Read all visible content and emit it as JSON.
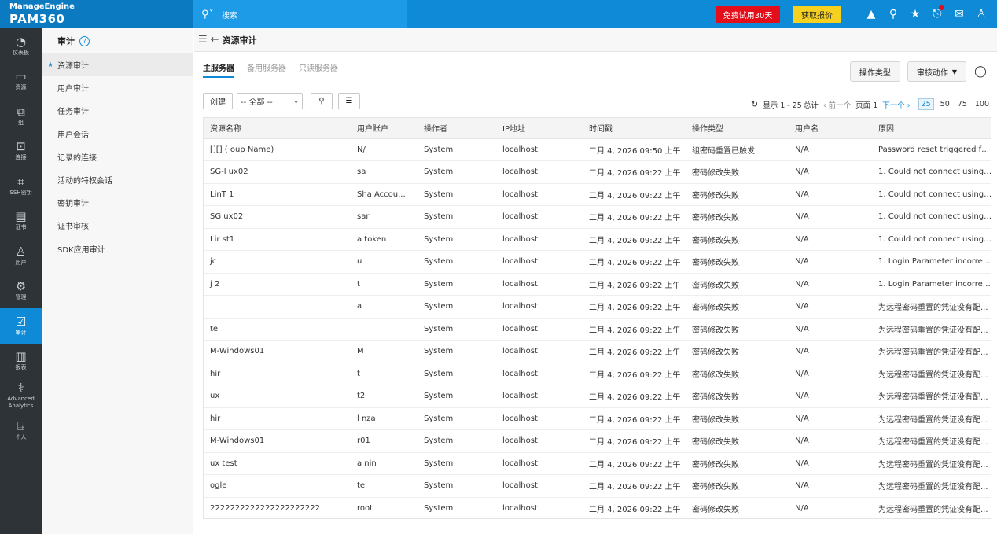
{
  "brand": {
    "line1": "ManageEngine",
    "line2": "PAM360"
  },
  "search": {
    "placeholder": "搜索"
  },
  "header_buttons": {
    "trial": "免费试用30天",
    "quote": "获取报价"
  },
  "leftnav": [
    {
      "icon": "dashboard-icon",
      "glyph": "◔",
      "label": "仪表板"
    },
    {
      "icon": "resources-icon",
      "glyph": "▭",
      "label": "资源"
    },
    {
      "icon": "groups-icon",
      "glyph": "⧉",
      "label": "组"
    },
    {
      "icon": "connections-icon",
      "glyph": "⊡",
      "label": "连接"
    },
    {
      "icon": "ssh-key-icon",
      "glyph": "⌗",
      "label": "SSH密钥"
    },
    {
      "icon": "certificate-icon",
      "glyph": "▤",
      "label": "证书"
    },
    {
      "icon": "users-icon",
      "glyph": "♙",
      "label": "用户"
    },
    {
      "icon": "admin-gear-icon",
      "glyph": "⚙",
      "label": "管理"
    },
    {
      "icon": "audit-icon",
      "glyph": "☑",
      "label": "审计",
      "active": true
    },
    {
      "icon": "reports-icon",
      "glyph": "▥",
      "label": "报表"
    },
    {
      "icon": "analytics-icon",
      "glyph": "⚕",
      "label": "Advanced Analytics"
    },
    {
      "icon": "personal-icon",
      "glyph": "⍈",
      "label": "个人"
    }
  ],
  "subnav": {
    "title": "审计",
    "help": "?",
    "items": [
      "资源审计",
      "用户审计",
      "任务审计",
      "用户会话",
      "记录的连接",
      "活动的特权会话",
      "密钥审计",
      "证书审核",
      "SDK应用审计"
    ]
  },
  "main": {
    "title": "资源审计",
    "tabs": [
      "主服务器",
      "备用服务器",
      "只读服务器"
    ],
    "btn_op_type": "操作类型",
    "btn_audit_action": "审核动作",
    "btn_create": "创建",
    "filter_value": "-- 全部 --",
    "paging": {
      "showing": "显示 1 - 25",
      "total": "总计",
      "prev": "‹ 前一个",
      "page": "页面 1",
      "next": "下一个 ›",
      "sizes": [
        "25",
        "50",
        "75",
        "100"
      ]
    }
  },
  "table": {
    "columns": [
      "资源名称",
      "用户账户",
      "操作者",
      "IP地址",
      "时间戳",
      "操作类型",
      "用户名",
      "原因"
    ],
    "rows": [
      [
        "[][] (  oup Name)",
        "N/",
        "System",
        "localhost",
        "二月 4, 2026 09:50 上午",
        "组密码重置已触发",
        "N/A",
        "Password reset triggered fo..."
      ],
      [
        "SG-l   ux02",
        "sa",
        "System",
        "localhost",
        "二月 4, 2026 09:22 上午",
        "密码修改失败",
        "N/A",
        "1. Could not connect using ..."
      ],
      [
        "LinT   1",
        "Sha   Accou...",
        "System",
        "localhost",
        "二月 4, 2026 09:22 上午",
        "密码修改失败",
        "N/A",
        "1. Could not connect using ..."
      ],
      [
        "SG   ux02",
        "sar",
        "System",
        "localhost",
        "二月 4, 2026 09:22 上午",
        "密码修改失败",
        "N/A",
        "1. Could not connect using ..."
      ],
      [
        "Lir   st1",
        "a   token",
        "System",
        "localhost",
        "二月 4, 2026 09:22 上午",
        "密码修改失败",
        "N/A",
        "1. Could not connect using ..."
      ],
      [
        "jc",
        "u",
        "System",
        "localhost",
        "二月 4, 2026 09:22 上午",
        "密码修改失败",
        "N/A",
        "1. Login Parameter incorrec..."
      ],
      [
        "j   2",
        "t",
        "System",
        "localhost",
        "二月 4, 2026 09:22 上午",
        "密码修改失败",
        "N/A",
        "1. Login Parameter incorrec..."
      ],
      [
        "",
        "a",
        "System",
        "localhost",
        "二月 4, 2026 09:22 上午",
        "密码修改失败",
        "N/A",
        "为远程密码重置的凭证没有配..."
      ],
      [
        "   te",
        "",
        "System",
        "localhost",
        "二月 4, 2026 09:22 上午",
        "密码修改失败",
        "N/A",
        "为远程密码重置的凭证没有配..."
      ],
      [
        "   M-Windows01",
        "   M",
        "System",
        "localhost",
        "二月 4, 2026 09:22 上午",
        "密码修改失败",
        "N/A",
        "为远程密码重置的凭证没有配..."
      ],
      [
        "   hir",
        "   t",
        "System",
        "localhost",
        "二月 4, 2026 09:22 上午",
        "密码修改失败",
        "N/A",
        "为远程密码重置的凭证没有配..."
      ],
      [
        "   ux",
        "   t2",
        "System",
        "localhost",
        "二月 4, 2026 09:22 上午",
        "密码修改失败",
        "N/A",
        "为远程密码重置的凭证没有配..."
      ],
      [
        "   hir",
        "l   nza",
        "System",
        "localhost",
        "二月 4, 2026 09:22 上午",
        "密码修改失败",
        "N/A",
        "为远程密码重置的凭证没有配..."
      ],
      [
        "   M-Windows01",
        "   r01",
        "System",
        "localhost",
        "二月 4, 2026 09:22 上午",
        "密码修改失败",
        "N/A",
        "为远程密码重置的凭证没有配..."
      ],
      [
        "   ux test",
        "a   nin",
        "System",
        "localhost",
        "二月 4, 2026 09:22 上午",
        "密码修改失败",
        "N/A",
        "为远程密码重置的凭证没有配..."
      ],
      [
        "   ogle",
        "te",
        "System",
        "localhost",
        "二月 4, 2026 09:22 上午",
        "密码修改失败",
        "N/A",
        "为远程密码重置的凭证没有配..."
      ],
      [
        "2222222222222222222222",
        "root",
        "System",
        "localhost",
        "二月 4, 2026 09:22 上午",
        "密码修改失败",
        "N/A",
        "为远程密码重置的凭证没有配..."
      ]
    ]
  }
}
